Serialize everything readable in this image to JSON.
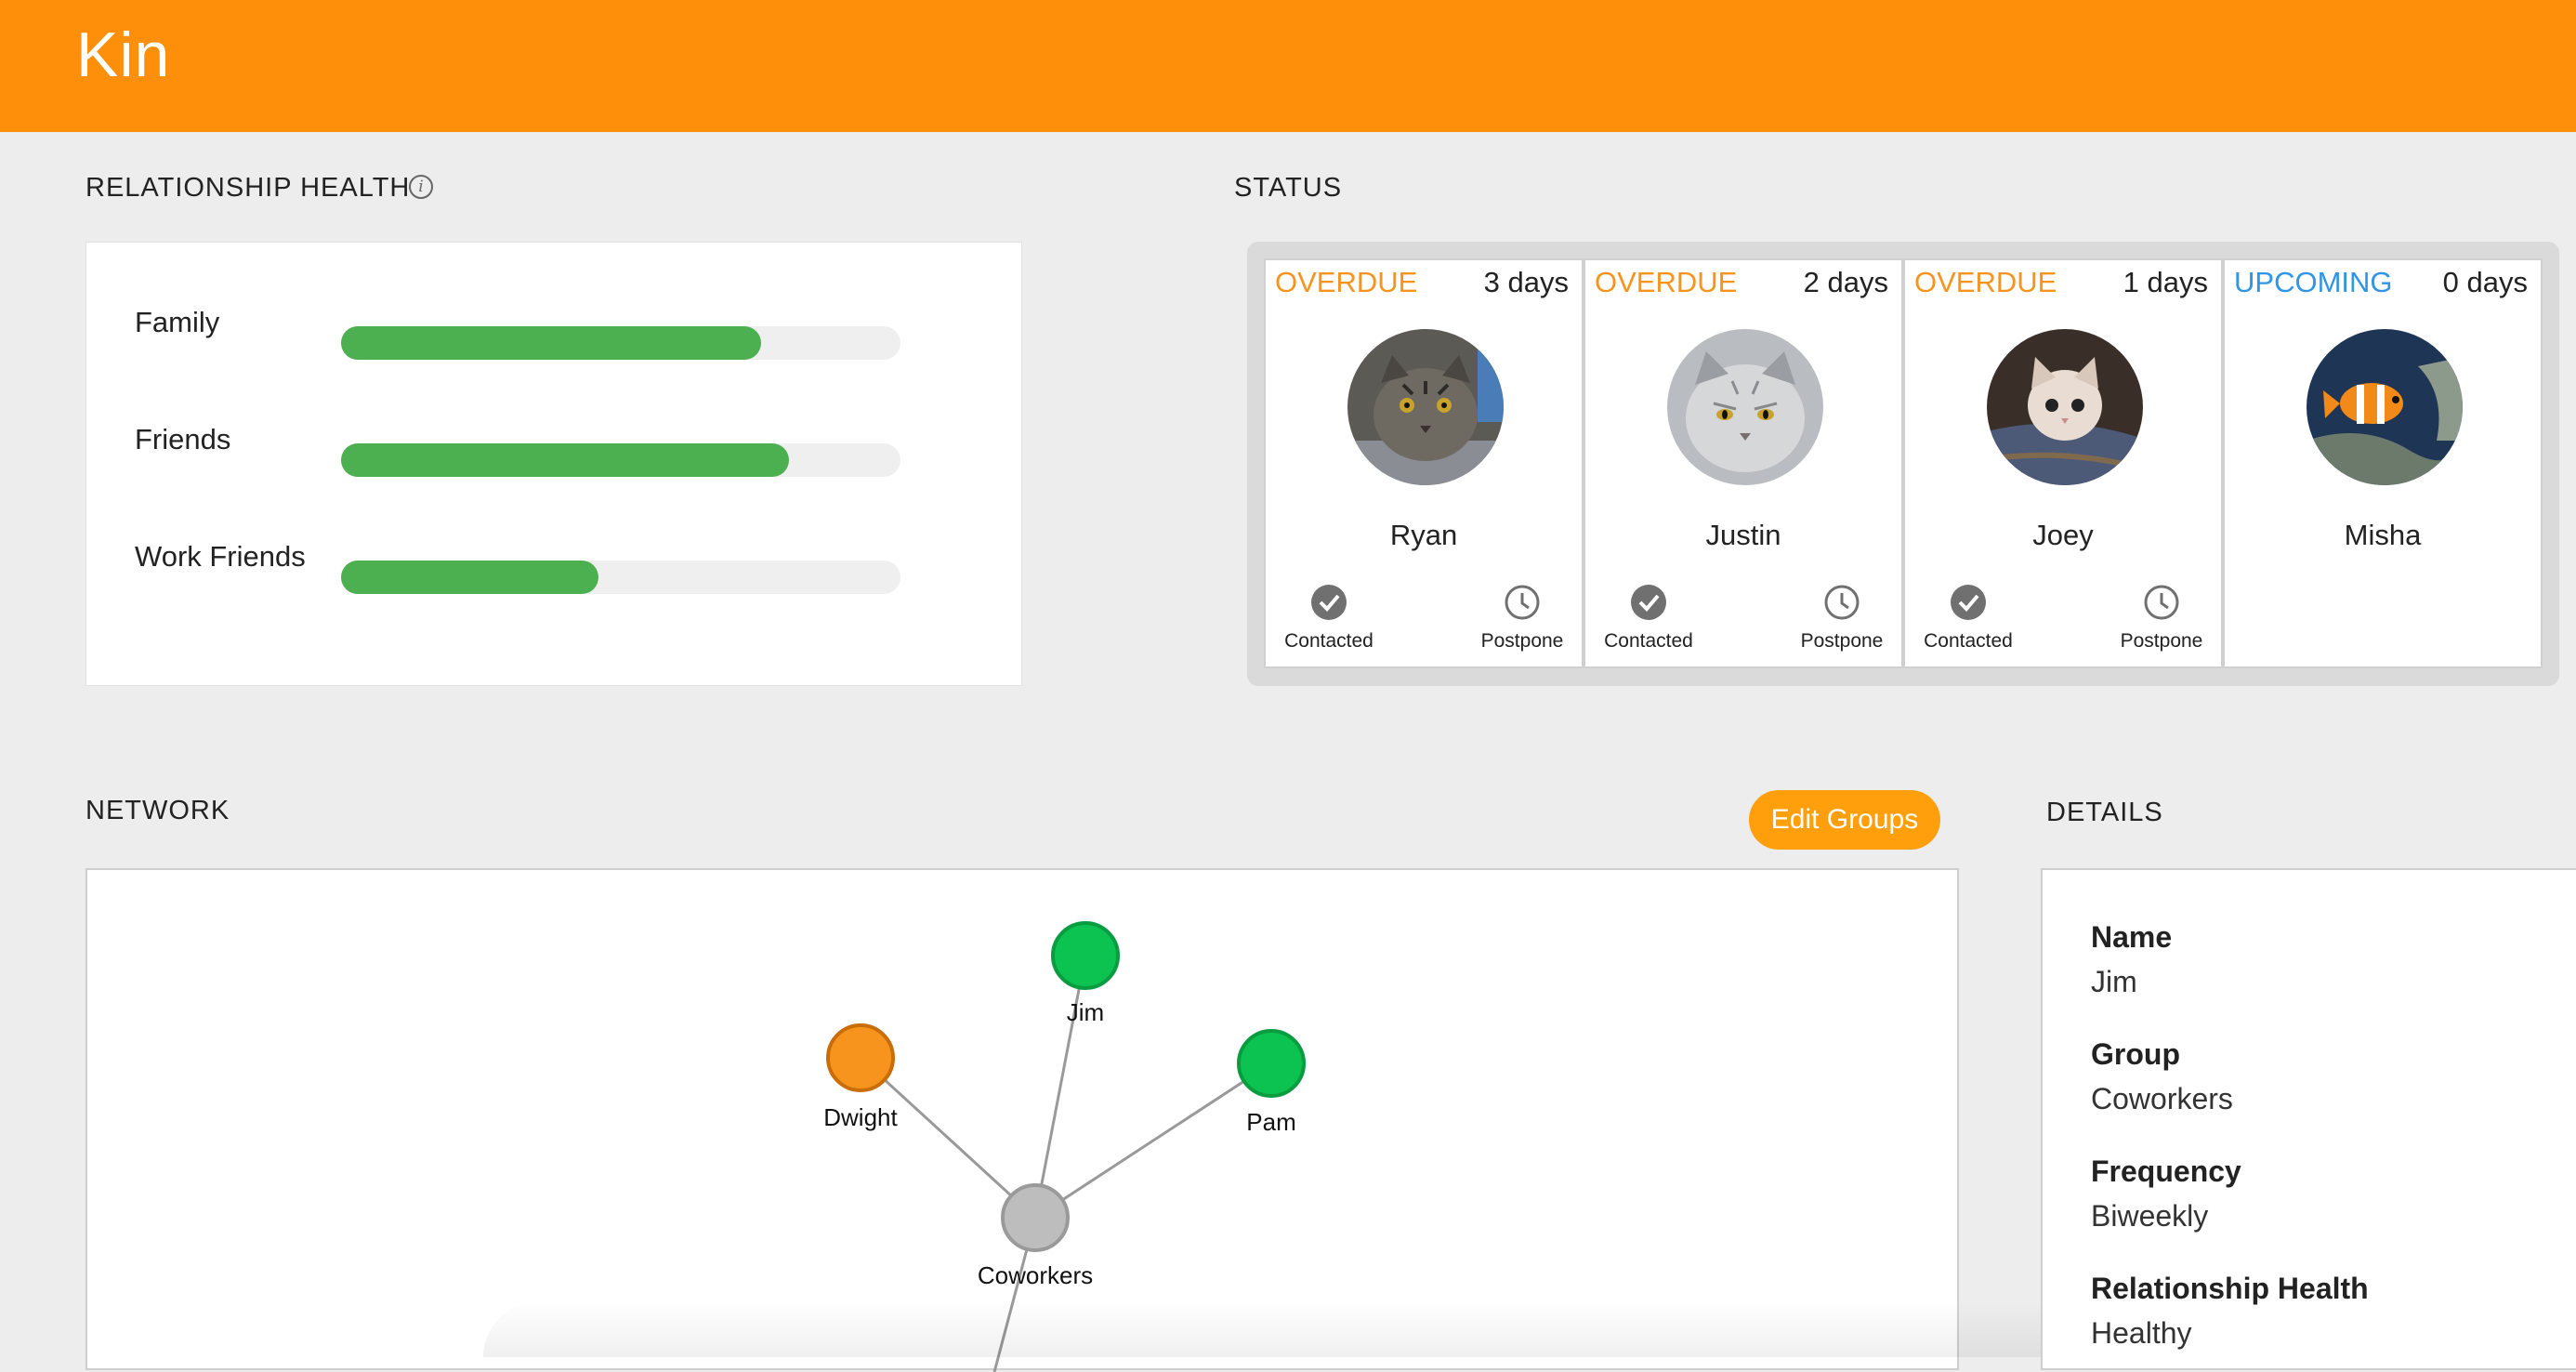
{
  "app": {
    "title": "Kin"
  },
  "health": {
    "title": "RELATIONSHIP HEALTH",
    "info_icon": "info-icon",
    "bar_color": "#4caf50",
    "items": [
      {
        "label": "Family",
        "level": 0.75
      },
      {
        "label": "Friends",
        "level": 0.8
      },
      {
        "label": "Work Friends",
        "level": 0.46
      }
    ]
  },
  "status": {
    "title": "STATUS",
    "colors": {
      "overdue": "#f7941d",
      "upcoming": "#2f95e4"
    },
    "cards": [
      {
        "tag": "OVERDUE",
        "days": "3 days",
        "name": "Ryan",
        "contacted": "Contacted",
        "postpone": "Postpone"
      },
      {
        "tag": "OVERDUE",
        "days": "2 days",
        "name": "Justin",
        "contacted": "Contacted",
        "postpone": "Postpone"
      },
      {
        "tag": "OVERDUE",
        "days": "1 days",
        "name": "Joey",
        "contacted": "Contacted",
        "postpone": "Postpone"
      },
      {
        "tag": "UPCOMING",
        "days": "0 days",
        "name": "Misha"
      }
    ]
  },
  "network": {
    "title": "NETWORK",
    "edit_button": "Edit Groups",
    "nodes": [
      {
        "label": "Jim",
        "color": "#0cc251"
      },
      {
        "label": "Dwight",
        "color": "#f7941d"
      },
      {
        "label": "Pam",
        "color": "#0cc251"
      },
      {
        "label": "Coworkers",
        "color": "#bdbdbd"
      }
    ]
  },
  "details": {
    "title": "DETAILS",
    "fields": [
      {
        "key": "Name",
        "value": "Jim"
      },
      {
        "key": "Group",
        "value": "Coworkers"
      },
      {
        "key": "Frequency",
        "value": "Biweekly"
      },
      {
        "key": "Relationship Health",
        "value": "Healthy"
      }
    ]
  }
}
